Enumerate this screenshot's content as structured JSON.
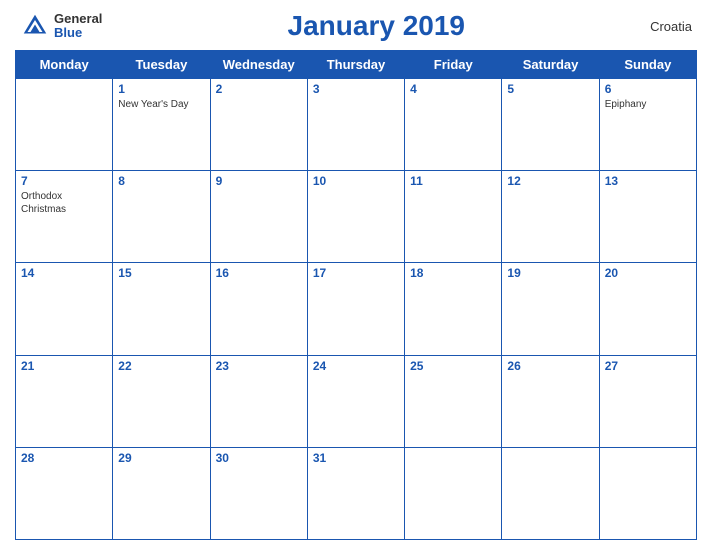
{
  "header": {
    "logo_general": "General",
    "logo_blue": "Blue",
    "month_title": "January 2019",
    "country": "Croatia"
  },
  "days_of_week": [
    "Monday",
    "Tuesday",
    "Wednesday",
    "Thursday",
    "Friday",
    "Saturday",
    "Sunday"
  ],
  "weeks": [
    [
      {
        "day": "",
        "holiday": ""
      },
      {
        "day": "1",
        "holiday": "New Year's Day"
      },
      {
        "day": "2",
        "holiday": ""
      },
      {
        "day": "3",
        "holiday": ""
      },
      {
        "day": "4",
        "holiday": ""
      },
      {
        "day": "5",
        "holiday": ""
      },
      {
        "day": "6",
        "holiday": "Epiphany"
      }
    ],
    [
      {
        "day": "7",
        "holiday": "Orthodox Christmas"
      },
      {
        "day": "8",
        "holiday": ""
      },
      {
        "day": "9",
        "holiday": ""
      },
      {
        "day": "10",
        "holiday": ""
      },
      {
        "day": "11",
        "holiday": ""
      },
      {
        "day": "12",
        "holiday": ""
      },
      {
        "day": "13",
        "holiday": ""
      }
    ],
    [
      {
        "day": "14",
        "holiday": ""
      },
      {
        "day": "15",
        "holiday": ""
      },
      {
        "day": "16",
        "holiday": ""
      },
      {
        "day": "17",
        "holiday": ""
      },
      {
        "day": "18",
        "holiday": ""
      },
      {
        "day": "19",
        "holiday": ""
      },
      {
        "day": "20",
        "holiday": ""
      }
    ],
    [
      {
        "day": "21",
        "holiday": ""
      },
      {
        "day": "22",
        "holiday": ""
      },
      {
        "day": "23",
        "holiday": ""
      },
      {
        "day": "24",
        "holiday": ""
      },
      {
        "day": "25",
        "holiday": ""
      },
      {
        "day": "26",
        "holiday": ""
      },
      {
        "day": "27",
        "holiday": ""
      }
    ],
    [
      {
        "day": "28",
        "holiday": ""
      },
      {
        "day": "29",
        "holiday": ""
      },
      {
        "day": "30",
        "holiday": ""
      },
      {
        "day": "31",
        "holiday": ""
      },
      {
        "day": "",
        "holiday": ""
      },
      {
        "day": "",
        "holiday": ""
      },
      {
        "day": "",
        "holiday": ""
      }
    ]
  ]
}
